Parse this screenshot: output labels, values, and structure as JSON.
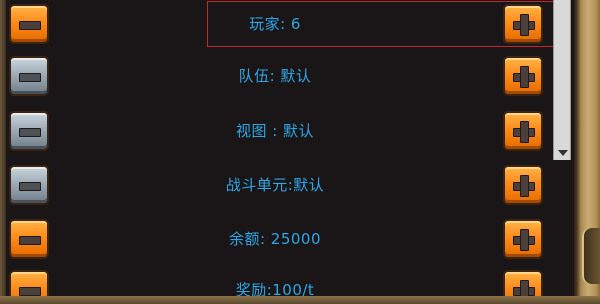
{
  "settings": {
    "rows": [
      {
        "label": "玩家: 6",
        "minus_style": "orange",
        "plus_style": "orange"
      },
      {
        "label": "队伍: 默认",
        "minus_style": "gray",
        "plus_style": "orange"
      },
      {
        "label": "视图 : 默认",
        "minus_style": "gray",
        "plus_style": "orange"
      },
      {
        "label": "战斗单元:默认",
        "minus_style": "gray",
        "plus_style": "orange"
      },
      {
        "label": "余额: 25000",
        "minus_style": "orange",
        "plus_style": "orange"
      },
      {
        "label": "奖励:100/t",
        "minus_style": "orange",
        "plus_style": "orange"
      }
    ],
    "highlighted_row": 0
  },
  "colors": {
    "label": "#2fa6e6",
    "highlight_border": "#c0282d",
    "button_orange": "#ff8c1a",
    "button_gray": "#9aa8b4"
  },
  "icons": {
    "minus": "minus-icon",
    "plus": "plus-icon",
    "scroll_down": "scroll-down-arrow-icon"
  }
}
